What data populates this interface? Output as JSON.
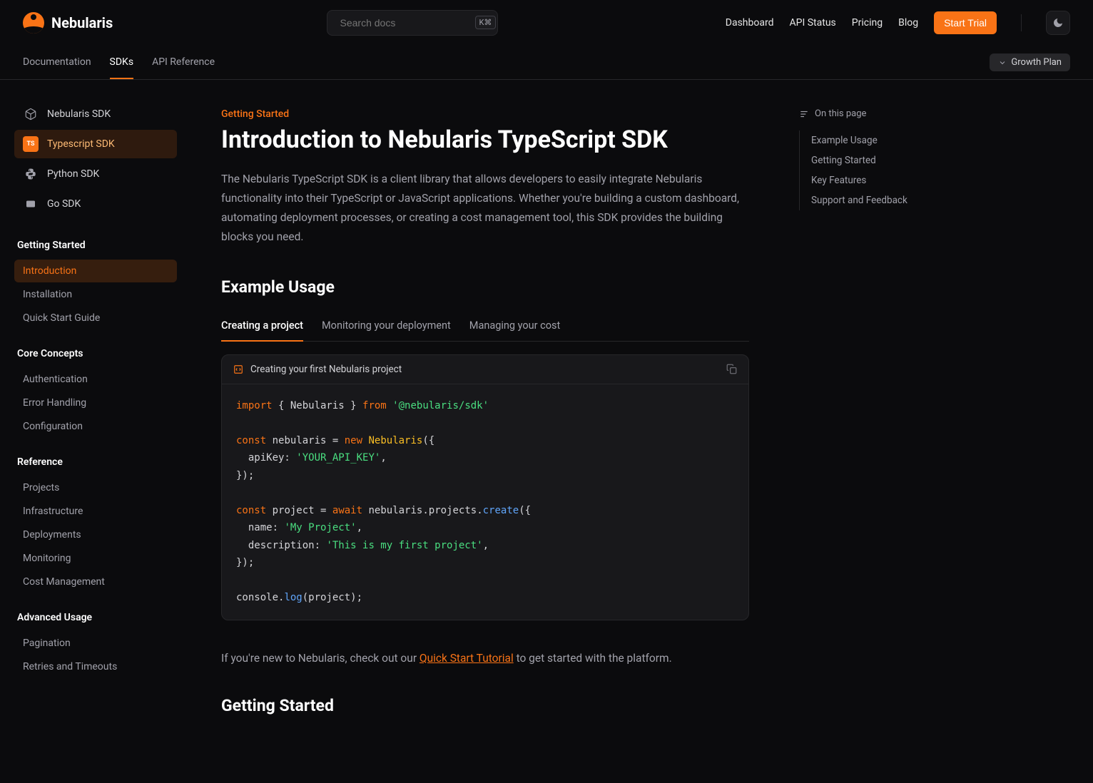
{
  "brand": "Nebularis",
  "search": {
    "placeholder": "Search docs",
    "shortcut": "K⌘"
  },
  "header_links": [
    "Dashboard",
    "API Status",
    "Pricing",
    "Blog"
  ],
  "trial_button": "Start Trial",
  "subnav": [
    "Documentation",
    "SDKs",
    "API Reference"
  ],
  "subnav_active": 1,
  "plan": "Growth Plan",
  "sdks": [
    {
      "label": "Nebularis SDK",
      "icon": "cube"
    },
    {
      "label": "Typescript SDK",
      "icon": "ts",
      "active": true
    },
    {
      "label": "Python SDK",
      "icon": "python"
    },
    {
      "label": "Go SDK",
      "icon": "go"
    }
  ],
  "sidebar_sections": [
    {
      "title": "Getting Started",
      "items": [
        "Introduction",
        "Installation",
        "Quick Start Guide"
      ],
      "active": 0
    },
    {
      "title": "Core Concepts",
      "items": [
        "Authentication",
        "Error Handling",
        "Configuration"
      ]
    },
    {
      "title": "Reference",
      "items": [
        "Projects",
        "Infrastructure",
        "Deployments",
        "Monitoring",
        "Cost Management"
      ]
    },
    {
      "title": "Advanced Usage",
      "items": [
        "Pagination",
        "Retries and Timeouts"
      ]
    }
  ],
  "page": {
    "eyebrow": "Getting Started",
    "title": "Introduction to Nebularis TypeScript SDK",
    "intro": "The Nebularis TypeScript SDK is a client library that allows developers to easily integrate Nebularis functionality into their TypeScript or JavaScript applications. Whether you're building a custom dashboard, automating deployment processes, or creating a cost management tool, this SDK provides the building blocks you need.",
    "example_heading": "Example Usage",
    "code_tabs": [
      "Creating a project",
      "Monitoring your deployment",
      "Managing your cost"
    ],
    "code_tabs_active": 0,
    "code_title": "Creating your first Nebularis project",
    "footer_pre": "If you're new to Nebularis, check out our ",
    "footer_link": "Quick Start Tutorial",
    "footer_post": " to get started with the platform.",
    "getting_started_heading": "Getting Started"
  },
  "toc": {
    "title": "On this page",
    "items": [
      "Example Usage",
      "Getting Started",
      "Key Features",
      "Support and Feedback"
    ]
  },
  "code": {
    "kw_import": "import",
    "braces_open": " { Nebularis } ",
    "kw_from": "from",
    "sp": " ",
    "pkg": "'@nebularis/sdk'",
    "kw_const": "const",
    "var_neb": " nebularis ",
    "eq": "=",
    "kw_new": "new",
    "cls_neb": "Nebularis",
    "paren_brace": "({",
    "apikey_line": "  apiKey: ",
    "apikey_val": "'YOUR_API_KEY'",
    "comma": ",",
    "close_call": "});",
    "var_proj": " project ",
    "kw_await": "await",
    "chain_pre": " nebularis.projects.",
    "fn_create": "create",
    "name_line": "  name: ",
    "name_val": "'My Project'",
    "desc_line": "  description: ",
    "desc_val": "'This is my first project'",
    "console_pre": "console.",
    "fn_log": "log",
    "log_arg": "(project);"
  }
}
